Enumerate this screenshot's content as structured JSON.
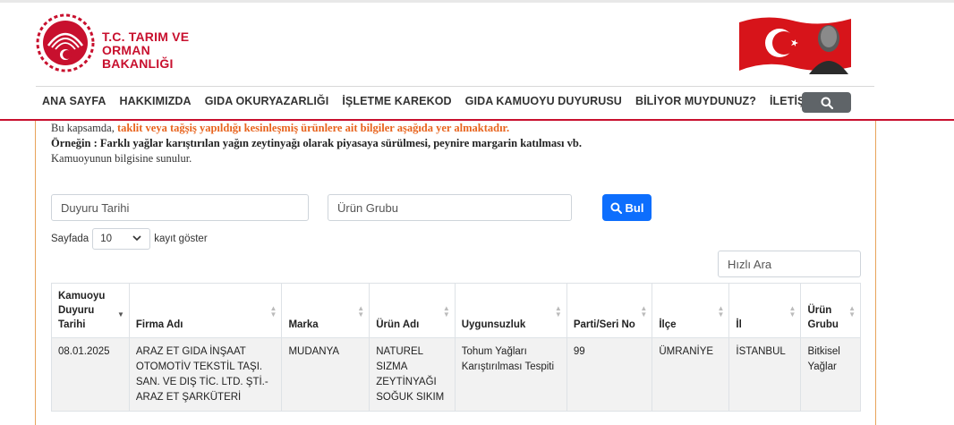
{
  "header": {
    "logo_line1": "T.C. TARIM VE",
    "logo_line2": "ORMAN BAKANLIĞI",
    "brand_color": "#c8102e",
    "logo_icon": "ministry-emblem-icon",
    "flag_icon": "turkish-flag-portrait-icon"
  },
  "nav": {
    "items": [
      "ANA SAYFA",
      "HAKKIMIZDA",
      "GIDA OKURYAZARLIĞI",
      "İŞLETME KAREKOD",
      "GIDA KAMUOYU DUYURUSU",
      "BİLİYOR MUYDUNUZ?",
      "İLETİŞİM"
    ],
    "search_icon": "search-icon"
  },
  "intro": {
    "line1_prefix": "Bu kapsamda, ",
    "line1_highlight": "taklit veya tağşiş yapıldığı kesinleşmiş ürünlere ait bilgiler aşağıda yer almaktadır.",
    "line2": "Örneğin : Farklı yağlar karıştırılan yağın zeytinyağı olarak piyasaya sürülmesi, peynire margarin katılması vb.",
    "line3": "Kamuoyunun bilgisine sunulur."
  },
  "filters": {
    "date_placeholder": "Duyuru Tarihi",
    "group_placeholder": "Ürün Grubu",
    "search_button": "Bul",
    "accent": "#0d6efd"
  },
  "pager": {
    "prefix": "Sayfada",
    "page_size": "10",
    "suffix": "kayıt göster"
  },
  "quick_search": {
    "placeholder": "Hızlı Ara"
  },
  "table": {
    "headers": [
      "Kamuoyu Duyuru Tarihi",
      "Firma Adı",
      "Marka",
      "Ürün Adı",
      "Uygunsuzluk",
      "Parti/Seri No",
      "İlçe",
      "İl",
      "Ürün Grubu"
    ],
    "rows": [
      {
        "date": "08.01.2025",
        "firm": "ARAZ ET GIDA İNŞAAT OTOMOTİV TEKSTİL TAŞI. SAN. VE DIŞ TİC. LTD. ŞTİ.- ARAZ ET ŞARKÜTERİ",
        "brand": "MUDANYA",
        "product": "NATUREL SIZMA ZEYTİNYAĞI SOĞUK SIKIM",
        "issue": "Tohum Yağları Karıştırılması Tespiti",
        "batch": "99",
        "district": "ÜMRANİYE",
        "city": "İSTANBUL",
        "group": "Bitkisel Yağlar"
      }
    ]
  }
}
